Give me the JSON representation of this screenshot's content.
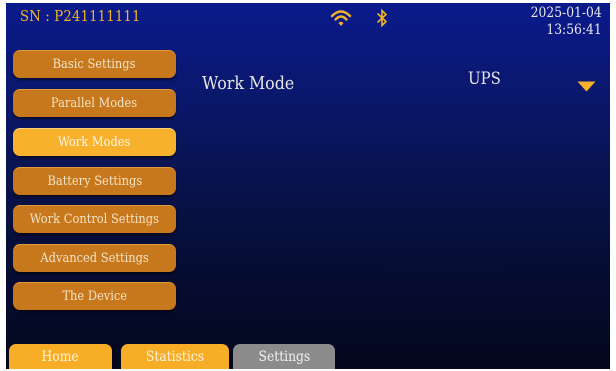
{
  "header": {
    "serial_number": "SN : P241111111",
    "date": "2025-01-04",
    "time": "13:56:41",
    "icons": [
      "wifi-icon",
      "bluetooth-icon"
    ]
  },
  "sidebar": {
    "items": [
      {
        "label": "Basic Settings",
        "active": false
      },
      {
        "label": "Parallel Modes",
        "active": false
      },
      {
        "label": "Work Modes",
        "active": true
      },
      {
        "label": "Battery Settings",
        "active": false
      },
      {
        "label": "Work Control Settings",
        "active": false
      },
      {
        "label": "Advanced Settings",
        "active": false
      },
      {
        "label": "The Device",
        "active": false
      }
    ]
  },
  "main": {
    "work_mode_label": "Work Mode",
    "work_mode_value": "UPS"
  },
  "tabs": [
    {
      "label": "Home"
    },
    {
      "label": "Statistics"
    },
    {
      "label": "Settings"
    }
  ],
  "colors": {
    "accent": "#f8b12d",
    "button": "#c7781c",
    "inactive_tab": "#8b8b8b",
    "background_top": "#0a1a8c",
    "background_bottom": "#03071c"
  }
}
